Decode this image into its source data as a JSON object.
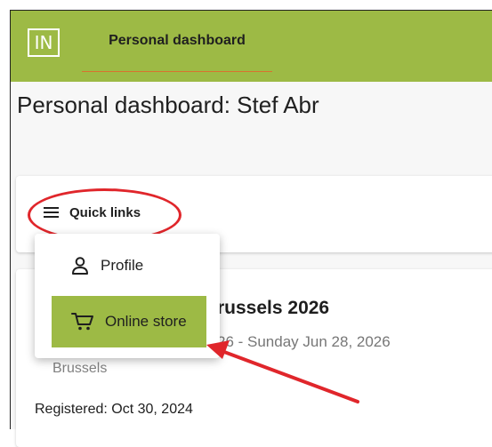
{
  "app": {
    "logo_text": "IN",
    "nav_tab_label": "Personal dashboard"
  },
  "page": {
    "title": "Personal dashboard: Stef Abr"
  },
  "quick_links": {
    "button_label": "Quick links",
    "menu_items": [
      {
        "label": "Profile",
        "icon": "person-icon"
      },
      {
        "label": "Online store",
        "icon": "cart-icon",
        "highlighted": true
      }
    ]
  },
  "event": {
    "title_partial": "russels 2026",
    "dates_partial": "26 - Sunday Jun 28, 2026",
    "location": "Brussels",
    "registered": "Registered: Oct 30, 2024"
  },
  "colors": {
    "accent": "#9dba45",
    "tab_underline": "#d9722f",
    "annotation": "#e0262b"
  }
}
